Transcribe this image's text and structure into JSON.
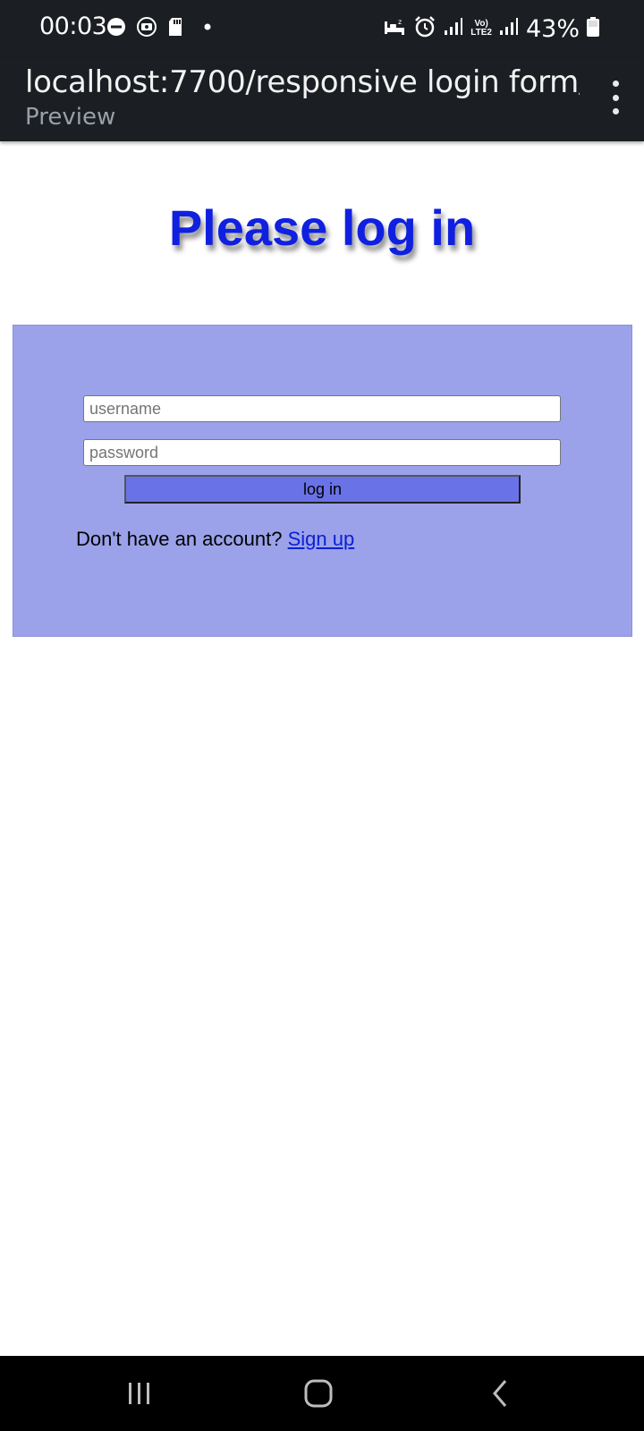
{
  "status_bar": {
    "time": "00:03",
    "battery": "43%",
    "network_label_top": "Vo)",
    "network_label_bottom": "LTE2",
    "left_icons": [
      "do-not-disturb-icon",
      "screen-record-icon",
      "sd-card-icon",
      "notification-dot-icon"
    ],
    "right_icons": [
      "bedtime-icon",
      "alarm-icon",
      "signal-icon",
      "volte-icon",
      "signal-icon",
      "battery-icon"
    ]
  },
  "url_bar": {
    "url": "localhost:7700/responsive login form/...",
    "subtitle": "Preview",
    "menu_icon": "more-vert-icon"
  },
  "page": {
    "heading": "Please log in",
    "heading_color": "#1020e0",
    "panel_color": "#9ba2ea",
    "form": {
      "username_placeholder": "username",
      "username_value": "",
      "password_placeholder": "password",
      "password_value": "",
      "login_label": "log in",
      "login_button_color": "#6a72e8"
    },
    "signup": {
      "prompt": "Don't have an account?",
      "link_label": "Sign up"
    }
  },
  "nav_bar": {
    "buttons": [
      "recents-icon",
      "home-icon",
      "back-icon"
    ]
  }
}
